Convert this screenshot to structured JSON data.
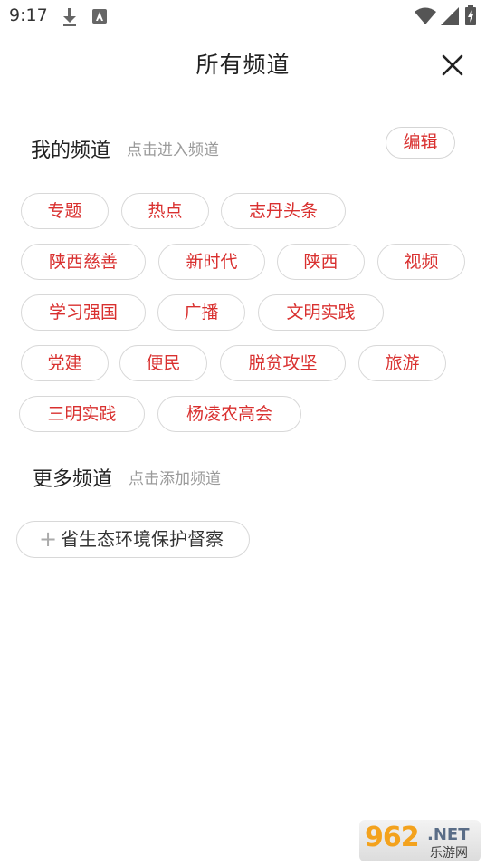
{
  "status_bar": {
    "time": "9:17",
    "icons": [
      "download-icon",
      "a-badge-icon",
      "wifi-icon",
      "signal-icon",
      "battery-icon"
    ]
  },
  "header": {
    "title": "所有频道",
    "close_icon": "close-icon"
  },
  "my_channels": {
    "title": "我的频道",
    "hint": "点击进入频道",
    "edit_label": "编辑",
    "channels": [
      "专题",
      "热点",
      "志丹头条",
      "陕西慈善",
      "新时代",
      "陕西",
      "视频",
      "学习强国",
      "广播",
      "文明实践",
      "党建",
      "便民",
      "脱贫攻坚",
      "旅游",
      "三明实践",
      "杨凌农高会"
    ]
  },
  "more_channels": {
    "title": "更多频道",
    "hint": "点击添加频道",
    "items": [
      {
        "icon": "plus-icon",
        "label": "省生态环境保护督察"
      }
    ]
  },
  "watermark": {
    "number": "962",
    "domain": ".NET",
    "subtitle": "乐游网"
  },
  "colors": {
    "accent": "#d9302f",
    "text": "#222222",
    "hint": "#9a9a9a",
    "border": "#d8d8d8"
  }
}
